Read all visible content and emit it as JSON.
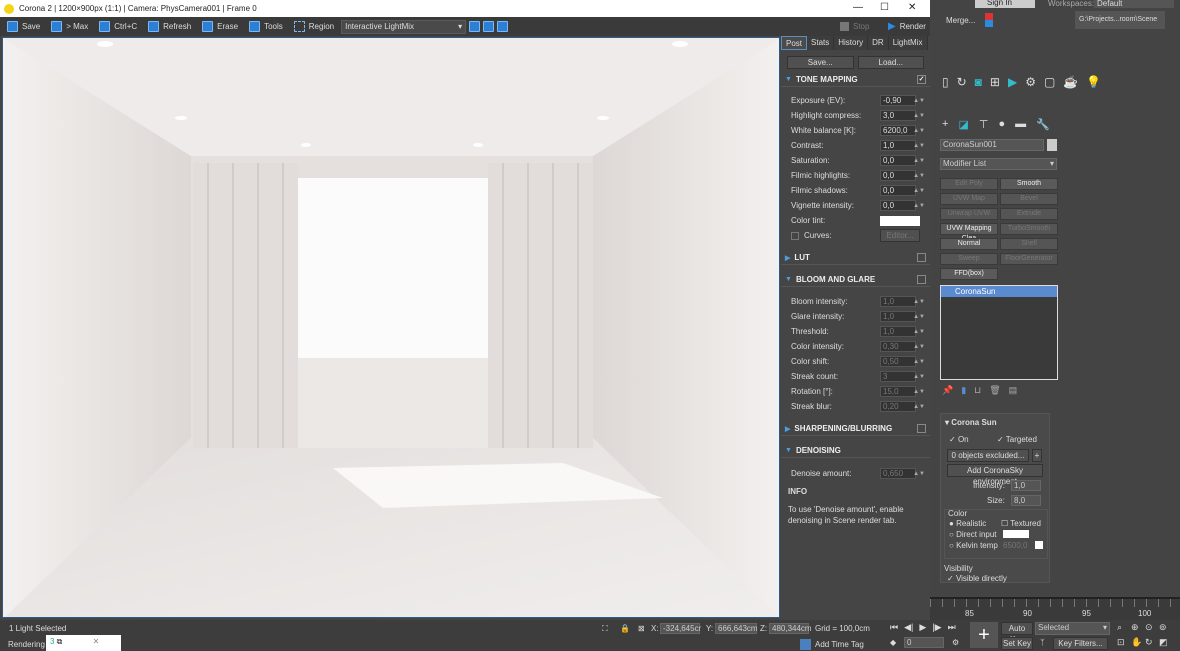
{
  "title": "Corona 2 | 1200×900px (1:1) | Camera: PhysCamera001 | Frame 0",
  "toolbar": {
    "save": "Save",
    "max": "> Max",
    "copy": "Ctrl+C",
    "refresh": "Refresh",
    "erase": "Erase",
    "tools": "Tools",
    "region": "Region",
    "lightmix": "Interactive LightMix",
    "stop": "Stop",
    "render": "Render"
  },
  "panel": {
    "tabs": [
      "Post",
      "Stats",
      "History",
      "DR",
      "LightMix"
    ],
    "save": "Save...",
    "load": "Load...",
    "tone_mapping": "TONE MAPPING",
    "tone": [
      {
        "l": "Exposure (EV):",
        "v": "-0,90"
      },
      {
        "l": "Highlight compress:",
        "v": "3,0"
      },
      {
        "l": "White balance [K]:",
        "v": "6200,0"
      },
      {
        "l": "Contrast:",
        "v": "1,0"
      },
      {
        "l": "Saturation:",
        "v": "0,0"
      },
      {
        "l": "Filmic highlights:",
        "v": "0,0"
      },
      {
        "l": "Filmic shadows:",
        "v": "0,0"
      },
      {
        "l": "Vignette intensity:",
        "v": "0,0"
      }
    ],
    "color_tint": "Color tint:",
    "curves": "Curves:",
    "editor": "Editor...",
    "lut": "LUT",
    "bloom": "BLOOM AND GLARE",
    "bloom_rows": [
      {
        "l": "Bloom intensity:",
        "v": "1,0"
      },
      {
        "l": "Glare intensity:",
        "v": "1,0"
      },
      {
        "l": "Threshold:",
        "v": "1,0"
      },
      {
        "l": "Color intensity:",
        "v": "0,30"
      },
      {
        "l": "Color shift:",
        "v": "0,50"
      },
      {
        "l": "Streak count:",
        "v": "3"
      },
      {
        "l": "Rotation [°]:",
        "v": "15,0"
      },
      {
        "l": "Streak blur:",
        "v": "0,20"
      }
    ],
    "sharpening": "SHARPENING/BLURRING",
    "denoising": "DENOISING",
    "denoise_label": "Denoise amount:",
    "denoise_val": "0,650",
    "info": "INFO",
    "info_text": "To use 'Denoise amount', enable denoising in Scene render tab."
  },
  "max": {
    "signin": "Sign In",
    "workspaces": "Workspaces:",
    "workspace": "Default",
    "merge": "Merge...",
    "project": "G:\\Projects...room\\Scene",
    "object_name": "CoronaSun001",
    "modifier_list": "Modifier List",
    "modifiers": [
      "Edit Poly",
      "Smooth",
      "UVW Map",
      "Bevel",
      "Unwrap UVW",
      "Extrude",
      "UVW Mapping Clea",
      "TurboSmooth",
      "Normal",
      "Shell",
      "Sweep",
      "FloorGenerator",
      "FFD(box)"
    ],
    "stack_item": "CoronaSun",
    "rollout": "Corona Sun",
    "on": "On",
    "targeted": "Targeted",
    "excluded": "0 objects excluded...",
    "add_sky": "Add CoronaSky environment",
    "intensity_l": "Intensity:",
    "intensity": "1,0",
    "size_l": "Size:",
    "size": "8,0",
    "color": "Color",
    "realistic": "Realistic",
    "textured": "Textured",
    "direct": "Direct input",
    "kelvin": "Kelvin temp",
    "kelvin_v": "6500,0",
    "visibility": "Visibility",
    "visible_directly": "Visible directly",
    "timeline": [
      "85",
      "90",
      "95",
      "100"
    ]
  },
  "status": {
    "selected": "1 Light Selected",
    "rendering": "Rendering T",
    "x": "-324,645cr",
    "y": "666,643cm",
    "z": "480,344cm",
    "grid": "Grid = 100,0cm",
    "add_time_tag": "Add Time Tag",
    "frame": "0",
    "auto_key": "Auto Key",
    "set_key": "Set Key",
    "key_mode": "Selected",
    "key_filters": "Key Filters..."
  }
}
